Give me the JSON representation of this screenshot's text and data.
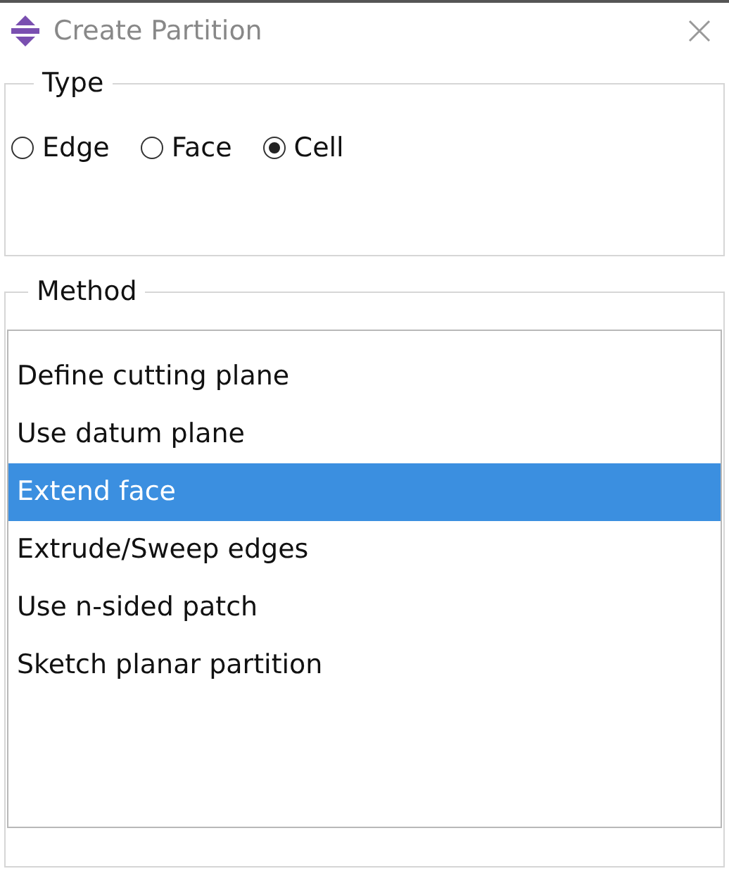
{
  "window": {
    "title": "Create Partition"
  },
  "type_group": {
    "label": "Type",
    "options": [
      {
        "label": "Edge",
        "selected": false
      },
      {
        "label": "Face",
        "selected": false
      },
      {
        "label": "Cell",
        "selected": true
      }
    ]
  },
  "method_group": {
    "label": "Method",
    "items": [
      {
        "label": "Define cutting plane",
        "selected": false
      },
      {
        "label": "Use datum plane",
        "selected": false
      },
      {
        "label": "Extend face",
        "selected": true
      },
      {
        "label": "Extrude/Sweep edges",
        "selected": false
      },
      {
        "label": "Use n-sided patch",
        "selected": false
      },
      {
        "label": "Sketch planar partition",
        "selected": false
      }
    ]
  }
}
